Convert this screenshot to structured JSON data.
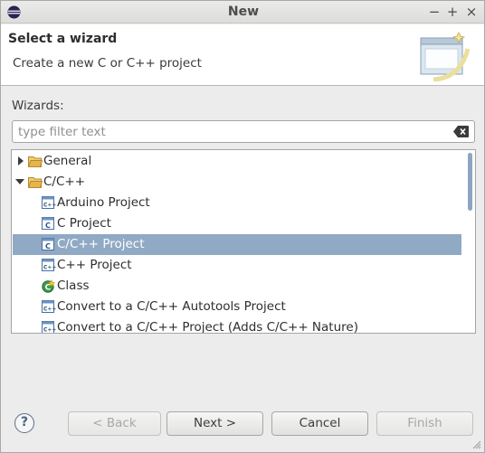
{
  "window": {
    "title": "New",
    "controls": {
      "minimize": "−",
      "maximize": "+",
      "close": "×"
    }
  },
  "header": {
    "title": "Select a wizard",
    "description": "Create a new C or C++ project"
  },
  "wizards": {
    "label": "Wizards:",
    "filter_placeholder": "type filter text",
    "filter_value": ""
  },
  "tree": {
    "items": [
      {
        "label": "General",
        "icon": "folder-icon",
        "expanded": false
      },
      {
        "label": "C/C++",
        "icon": "folder-open-icon",
        "expanded": true
      },
      {
        "label": "Arduino Project",
        "icon": "cpp-project-icon"
      },
      {
        "label": "C Project",
        "icon": "c-project-icon"
      },
      {
        "label": "C/C++ Project",
        "icon": "cpp-project-icon",
        "selected": true
      },
      {
        "label": "C++ Project",
        "icon": "cpp-project-icon"
      },
      {
        "label": "Class",
        "icon": "class-icon"
      },
      {
        "label": "Convert to a C/C++ Autotools Project",
        "icon": "cpp-project-icon"
      },
      {
        "label": "Convert to a C/C++ Project (Adds C/C++ Nature)",
        "icon": "cpp-project-icon"
      }
    ]
  },
  "buttons": {
    "help": "?",
    "back": "< Back",
    "next": "Next >",
    "cancel": "Cancel",
    "finish": "Finish"
  },
  "colors": {
    "selection": "#90a9c5",
    "folder": "#e8b44c"
  }
}
